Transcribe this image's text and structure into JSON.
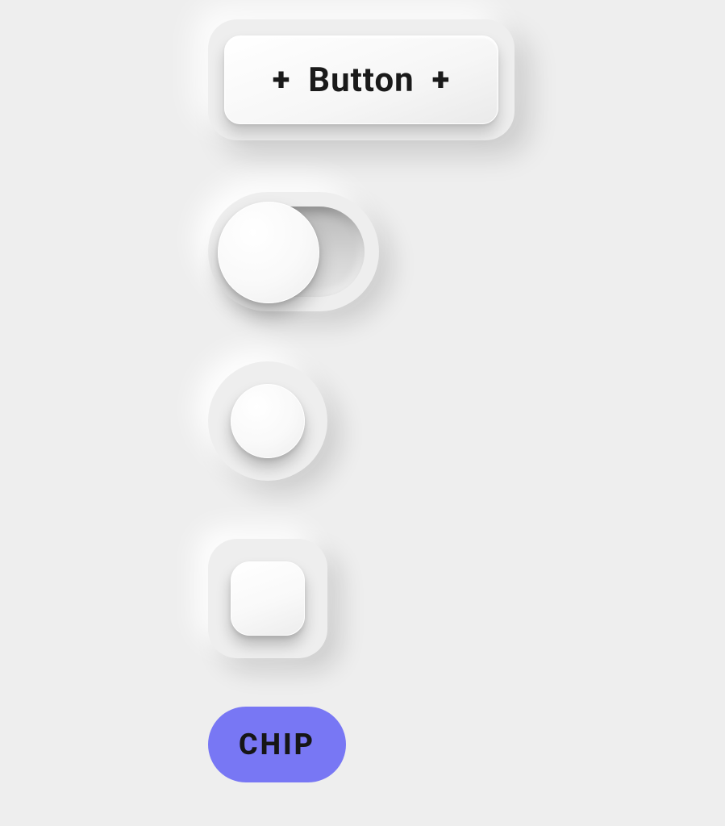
{
  "button": {
    "label": "Button",
    "left_icon": "+",
    "right_icon": "+"
  },
  "toggle": {
    "state": "off"
  },
  "radio": {
    "checked": false
  },
  "checkbox": {
    "checked": false
  },
  "chip": {
    "label": "CHIP",
    "color": "#7877f4"
  }
}
